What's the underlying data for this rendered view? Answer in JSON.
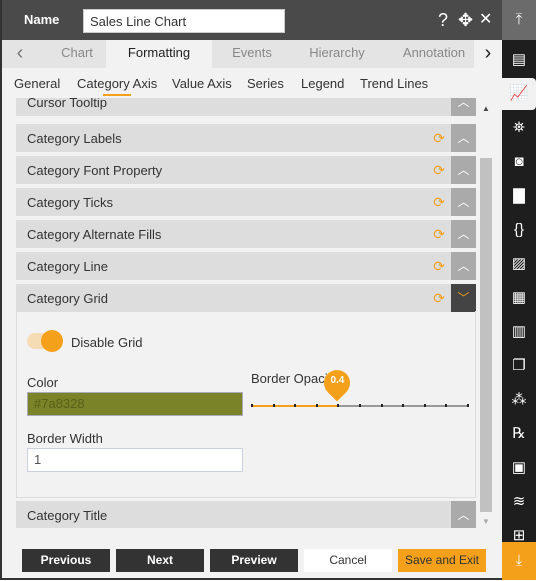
{
  "header": {
    "name_label": "Name",
    "name_value": "Sales Line Chart",
    "help": "?",
    "move": "✥",
    "close": "✕"
  },
  "tabs": [
    {
      "label": "Chart"
    },
    {
      "label": "Formatting",
      "active": true
    },
    {
      "label": "Events"
    },
    {
      "label": "Hierarchy"
    },
    {
      "label": "Annotation"
    }
  ],
  "subtabs": [
    {
      "label": "General"
    },
    {
      "label": "Category Axis",
      "active": true
    },
    {
      "label": "Value Axis"
    },
    {
      "label": "Series"
    },
    {
      "label": "Legend"
    },
    {
      "label": "Trend Lines"
    }
  ],
  "sections": [
    {
      "label": "Cursor Tooltip"
    },
    {
      "label": "Category Labels"
    },
    {
      "label": "Category Font Property"
    },
    {
      "label": "Category Ticks"
    },
    {
      "label": "Category Alternate Fills"
    },
    {
      "label": "Category Line"
    },
    {
      "label": "Category Grid",
      "expanded": true
    },
    {
      "label": "Category Title"
    }
  ],
  "grid": {
    "toggle_label": "Disable Grid",
    "toggle_on": true,
    "color_label": "Color",
    "color_value": "#7a8328",
    "opacity_label": "Border Opacity",
    "opacity_value": "0.4",
    "width_label": "Border Width",
    "width_value": "1"
  },
  "footer": {
    "previous": "Previous",
    "next": "Next",
    "preview": "Preview",
    "cancel": "Cancel",
    "save": "Save and Exit"
  },
  "colors": {
    "accent": "#f5a01a",
    "header": "#4a4a4a",
    "sidebar": "#1e1e1e"
  }
}
